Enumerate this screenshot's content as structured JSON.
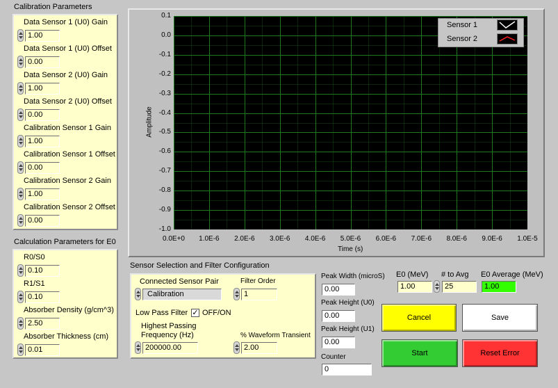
{
  "calibration": {
    "title": "Calibration Parameters",
    "items": [
      {
        "label": "Data Sensor 1 (U0) Gain",
        "value": "1.00"
      },
      {
        "label": "Data Sensor 1 (U0) Offset",
        "value": "0.00"
      },
      {
        "label": "Data Sensor 2 (U0) Gain",
        "value": "1.00"
      },
      {
        "label": "Data Sensor 2 (U0) Offset",
        "value": "0.00"
      },
      {
        "label": "Calibration Sensor 1 Gain",
        "value": "1.00"
      },
      {
        "label": "Calibration Sensor 1 Offset",
        "value": "0.00"
      },
      {
        "label": "Calibration Sensor 2 Gain",
        "value": "1.00"
      },
      {
        "label": "Calibration Sensor 2 Offset",
        "value": "0.00"
      }
    ]
  },
  "calculation": {
    "title": "Calculation Parameters for E0",
    "items": [
      {
        "label": "R0/S0",
        "value": "0.10"
      },
      {
        "label": "R1/S1",
        "value": "0.10"
      },
      {
        "label": "Absorber Density (g/cm^3)",
        "value": "2.50"
      },
      {
        "label": "Absorber Thickness (cm)",
        "value": "0.01"
      }
    ]
  },
  "sensor_config": {
    "title": "Sensor Selection and Filter Configuration",
    "pair_label": "Connected Sensor Pair",
    "pair_value": "Calibration",
    "filter_order_label": "Filter Order",
    "filter_order_value": "1",
    "low_pass_label": "Low Pass Filter",
    "checkbox_mark": "✓",
    "off_on_label": "OFF/ON",
    "highest_label_1": "Highest Passing",
    "highest_label_2": "Frequency (Hz)",
    "highest_value": "200000.00",
    "transient_label": "% Waveform Transient",
    "transient_value": "2.00"
  },
  "peaks": {
    "width_label": "Peak Width (microS)",
    "width_value": "0.00",
    "height_u0_label": "Peak Height (U0)",
    "height_u0_value": "0.00",
    "height_u1_label": "Peak Height (U1)",
    "height_u1_value": "0.00",
    "counter_label": "Counter",
    "counter_value": "0"
  },
  "e0": {
    "e0_label": "E0 (MeV)",
    "e0_value": "1.00",
    "avg_label": "# to Avg",
    "avg_value": "25",
    "average_label": "E0 Average (MeV)",
    "average_value": "1.00"
  },
  "buttons": {
    "cancel": "Cancel",
    "save": "Save",
    "start": "Start",
    "reset": "Reset Error"
  },
  "colors": {
    "cancel": "#ffff00",
    "save": "#ffffff",
    "start": "#33cc33",
    "reset": "#ff3333",
    "grid": "#1f7a1f",
    "panel": "#ffffcc"
  },
  "chart_data": {
    "type": "line",
    "ylabel": "Amplitude",
    "xlabel": "Time (s)",
    "ylim": [
      -1.0,
      0.1
    ],
    "xlim": [
      0,
      1e-05
    ],
    "y_ticks": [
      "0.1",
      "0.0",
      "-0.1",
      "-0.2",
      "-0.3",
      "-0.4",
      "-0.5",
      "-0.6",
      "-0.7",
      "-0.8",
      "-0.9",
      "-1.0"
    ],
    "x_ticks": [
      "0.0E+0",
      "1.0E-6",
      "2.0E-6",
      "3.0E-6",
      "4.0E-6",
      "5.0E-6",
      "6.0E-6",
      "7.0E-6",
      "8.0E-6",
      "9.0E-6",
      "1.0E-5"
    ],
    "grid": true,
    "legend_position": "top-right",
    "series": [
      {
        "name": "Sensor 1",
        "values": [],
        "color": "#ffffff"
      },
      {
        "name": "Sensor 2",
        "values": [],
        "color": "#ff2020"
      }
    ]
  }
}
